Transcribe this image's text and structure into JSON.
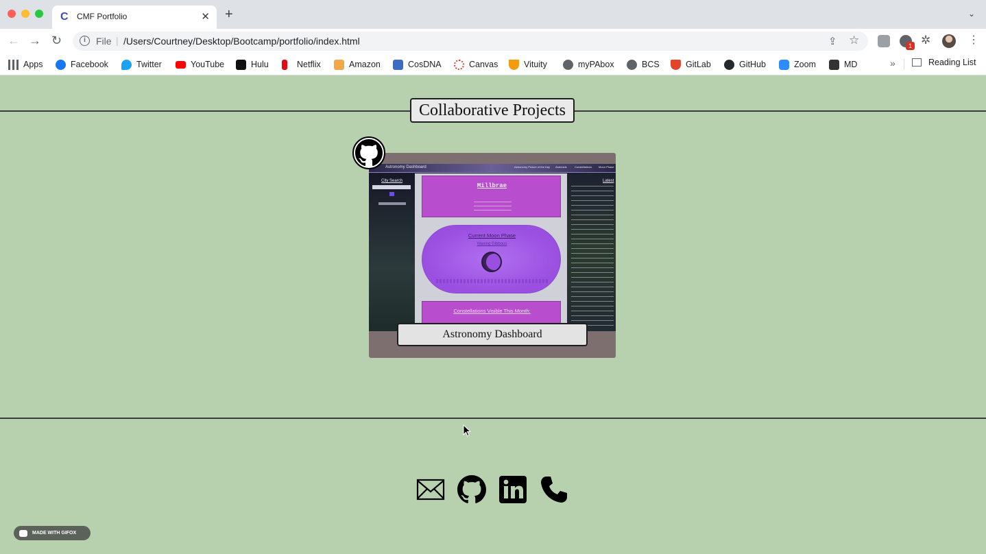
{
  "browser": {
    "tab": {
      "favicon_letter": "C",
      "title": "CMF Portfolio",
      "close": "✕"
    },
    "new_tab": "+",
    "tab_dropdown": "⌄",
    "nav": {
      "back": "←",
      "forward": "→",
      "reload": "↻"
    },
    "omnibox": {
      "info_icon": "i",
      "scheme": "File",
      "separator": "|",
      "url": "/Users/Courtney/Desktop/Bootcamp/portfolio/index.html"
    },
    "toolbar_icons": {
      "share": "⇪",
      "star": "☆",
      "puzzle": "✲",
      "menu": "⋮",
      "ext_badge": "1"
    },
    "bookmarks": [
      {
        "label": "Apps",
        "icon": "apps-grid-icon",
        "color": "#4285f4"
      },
      {
        "label": "Facebook",
        "icon": "facebook-icon",
        "color": "#1877f2"
      },
      {
        "label": "Twitter",
        "icon": "twitter-icon",
        "color": "#1da1f2"
      },
      {
        "label": "YouTube",
        "icon": "youtube-icon",
        "color": "#ff0000"
      },
      {
        "label": "Hulu",
        "icon": "hulu-icon",
        "color": "#111111"
      },
      {
        "label": "Netflix",
        "icon": "netflix-icon",
        "color": "#e50914"
      },
      {
        "label": "Amazon",
        "icon": "amazon-icon",
        "color": "#f3a847"
      },
      {
        "label": "CosDNA",
        "icon": "cosdna-icon",
        "color": "#3b6cc4"
      },
      {
        "label": "Canvas",
        "icon": "canvas-icon",
        "color": "#e13c2c"
      },
      {
        "label": "Vituity",
        "icon": "vituity-icon",
        "color": "#f39c12"
      },
      {
        "label": "myPAbox",
        "icon": "globe-icon",
        "color": "#5f6368"
      },
      {
        "label": "BCS",
        "icon": "globe-icon",
        "color": "#5f6368"
      },
      {
        "label": "GitLab",
        "icon": "gitlab-icon",
        "color": "#e24329"
      },
      {
        "label": "GitHub",
        "icon": "github-icon",
        "color": "#24292e"
      },
      {
        "label": "Zoom",
        "icon": "zoom-icon",
        "color": "#2d8cff"
      },
      {
        "label": "MD",
        "icon": "md-icon",
        "color": "#333333"
      }
    ],
    "bookmarks_more": "»",
    "reading_list": "Reading List"
  },
  "page": {
    "section_title": "Collaborative Projects",
    "project": {
      "caption": "Astronomy Dashboard",
      "preview": {
        "header_title": "Astronomy Dashboard",
        "header_links": [
          "Astronomy Picture of the Day",
          "Asteroids",
          "Constellations",
          "Moon Phase"
        ],
        "city_search": "City Search",
        "city_name": "Millbrae",
        "moon_title": "Current Moon Phase",
        "moon_phase": "Waxing Gibbous",
        "constellations_title": "Constellations Visible This Month:",
        "latest_title": "Latest"
      }
    },
    "contact_icons": [
      "mail-icon",
      "github-icon",
      "linkedin-icon",
      "phone-icon"
    ]
  },
  "watermark": "MADE WITH GIFOX",
  "colors": {
    "page_bg": "#b7d1af",
    "card_bg": "#7d6e70",
    "accent_purple": "#b84dcd"
  }
}
